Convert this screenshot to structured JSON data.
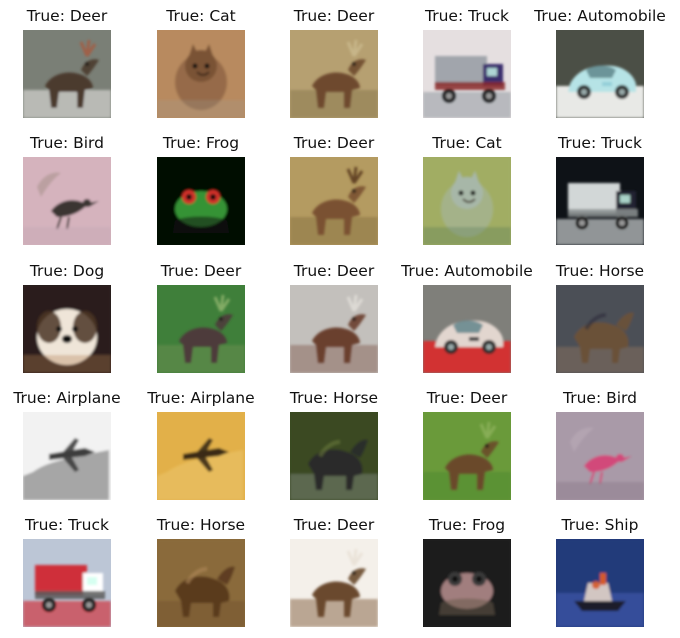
{
  "images": [
    {
      "title": "True: Deer",
      "icon": "deer-photo",
      "colors": [
        "#7a7f76",
        "#ecebea",
        "#4b3b2e",
        "#a45c43"
      ]
    },
    {
      "title": "True: Cat",
      "icon": "cat-photo",
      "colors": [
        "#b88a5e",
        "#9b9d99",
        "#c98d58",
        "#7a5236"
      ]
    },
    {
      "title": "True: Deer",
      "icon": "deer-photo",
      "colors": [
        "#b6a071",
        "#8a7a4f",
        "#6e4a2f",
        "#c9b98c"
      ]
    },
    {
      "title": "True: Truck",
      "icon": "truck-photo",
      "colors": [
        "#e5dfe0",
        "#9aa0a6",
        "#3b2f6d",
        "#8b2a2a"
      ]
    },
    {
      "title": "True: Automobile",
      "icon": "car-photo",
      "colors": [
        "#4b4f46",
        "#e8e9e6",
        "#8fcbd6",
        "#b6e3e6"
      ]
    },
    {
      "title": "True: Bird",
      "icon": "bird-photo",
      "colors": [
        "#d5b3bd",
        "#c9a9b6",
        "#3a3431",
        "#8c7f6c"
      ]
    },
    {
      "title": "True: Frog",
      "icon": "frog-photo",
      "colors": [
        "#050806",
        "#141a10",
        "#3aa33a",
        "#d2322a"
      ]
    },
    {
      "title": "True: Deer",
      "icon": "deer-photo",
      "colors": [
        "#b49b61",
        "#8b7444",
        "#7a5130",
        "#5b3a21"
      ]
    },
    {
      "title": "True: Cat",
      "icon": "cat-photo",
      "colors": [
        "#a1ad64",
        "#3e6a4e",
        "#6b5c3a",
        "#a7b7a8"
      ]
    },
    {
      "title": "True: Truck",
      "icon": "truck-photo",
      "colors": [
        "#0e1217",
        "#e8ecec",
        "#223",
        "#8a8f8f"
      ]
    },
    {
      "title": "True: Dog",
      "icon": "dog-photo",
      "colors": [
        "#2a1e1a",
        "#efe5d8",
        "#b48257",
        "#4b3626"
      ]
    },
    {
      "title": "True: Deer",
      "icon": "deer-photo",
      "colors": [
        "#3f7f3a",
        "#6a8e4f",
        "#4d3a3a",
        "#8ab16a"
      ]
    },
    {
      "title": "True: Deer",
      "icon": "deer-photo",
      "colors": [
        "#c3c0bc",
        "#8b6a5e",
        "#6a3f2f",
        "#e0ddd8"
      ]
    },
    {
      "title": "True: Automobile",
      "icon": "car-photo",
      "colors": [
        "#7f7f7a",
        "#d23232",
        "#2a2a2e",
        "#e2d6cf"
      ]
    },
    {
      "title": "True: Horse",
      "icon": "horse-photo",
      "colors": [
        "#4c4f56",
        "#a58262",
        "#6b5138",
        "#2b2b3b"
      ]
    },
    {
      "title": "True: Airplane",
      "icon": "airplane-photo",
      "colors": [
        "#f2f2f2",
        "#bdbdbd",
        "#3d3d3d",
        "#1b1b1b"
      ]
    },
    {
      "title": "True: Airplane",
      "icon": "airplane-photo",
      "colors": [
        "#e2b04a",
        "#b88428",
        "#3a2a15",
        "#f2d27a"
      ]
    },
    {
      "title": "True: Horse",
      "icon": "horse-photo",
      "colors": [
        "#3a4a22",
        "#9aa0a6",
        "#2a2a2a",
        "#6a7a3a"
      ]
    },
    {
      "title": "True: Deer",
      "icon": "deer-photo",
      "colors": [
        "#6a9a3a",
        "#4f8a32",
        "#6a4a2a",
        "#8bb15a"
      ]
    },
    {
      "title": "True: Bird",
      "icon": "bird-photo",
      "colors": [
        "#a99aa8",
        "#8f7f8e",
        "#d24a7a",
        "#c6b6c4"
      ]
    },
    {
      "title": "True: Truck",
      "icon": "truck-photo",
      "colors": [
        "#bcc6d6",
        "#d21e2a",
        "#ffffff",
        "#5a5a5a"
      ]
    },
    {
      "title": "True: Horse",
      "icon": "horse-photo",
      "colors": [
        "#8a6a3a",
        "#6a4a2a",
        "#5a3a1f",
        "#b08a5a"
      ]
    },
    {
      "title": "True: Deer",
      "icon": "deer-photo",
      "colors": [
        "#f4f0ea",
        "#8a6a4a",
        "#6a4a2f",
        "#e9e2d6"
      ]
    },
    {
      "title": "True: Frog",
      "icon": "frog-photo",
      "colors": [
        "#1a1a1a",
        "#6a5a4a",
        "#b08a8a",
        "#3a3a3a"
      ]
    },
    {
      "title": "True: Ship",
      "icon": "ship-photo",
      "colors": [
        "#233a7a",
        "#3b55a6",
        "#d2c6c2",
        "#d45a2a"
      ]
    }
  ]
}
